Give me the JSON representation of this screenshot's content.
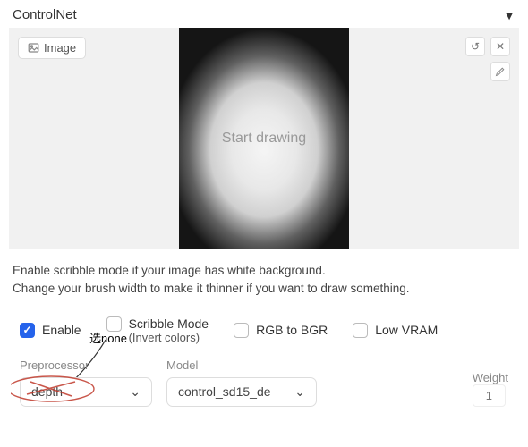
{
  "header": {
    "title": "ControlNet"
  },
  "canvas": {
    "image_button": "Image",
    "placeholder": "Start drawing"
  },
  "help": {
    "line1": "Enable scribble mode if your image has white background.",
    "line2": "Change your brush width to make it thinner if you want to draw something."
  },
  "options": {
    "enable": "Enable",
    "scribble": "Scribble Mode",
    "scribble_sub": "(Invert colors)",
    "rgb": "RGB to BGR",
    "lowvram": "Low VRAM"
  },
  "annotation": {
    "text": "选none"
  },
  "fields": {
    "preprocessor_label": "Preprocessor",
    "preprocessor_value": "depth",
    "model_label": "Model",
    "model_value": "control_sd15_de",
    "weight_label": "Weight",
    "weight_value": "1"
  }
}
